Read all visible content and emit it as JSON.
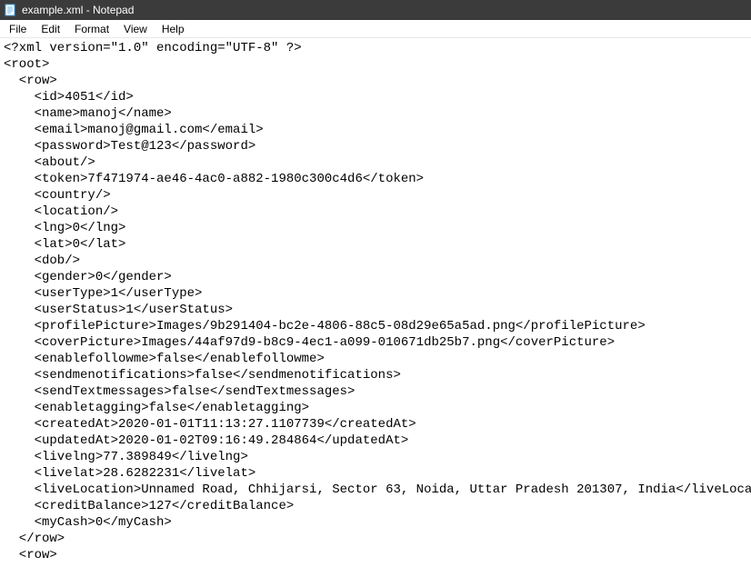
{
  "window": {
    "title": "example.xml - Notepad"
  },
  "menu": {
    "file": "File",
    "edit": "Edit",
    "format": "Format",
    "view": "View",
    "help": "Help"
  },
  "content": {
    "l0": "<?xml version=\"1.0\" encoding=\"UTF-8\" ?>",
    "l1": "<root>",
    "l2": "  <row>",
    "l3": "    <id>4051</id>",
    "l4": "    <name>manoj</name>",
    "l5": "    <email>manoj@gmail.com</email>",
    "l6": "    <password>Test@123</password>",
    "l7": "    <about/>",
    "l8": "    <token>7f471974-ae46-4ac0-a882-1980c300c4d6</token>",
    "l9": "    <country/>",
    "l10": "    <location/>",
    "l11": "    <lng>0</lng>",
    "l12": "    <lat>0</lat>",
    "l13": "    <dob/>",
    "l14": "    <gender>0</gender>",
    "l15": "    <userType>1</userType>",
    "l16": "    <userStatus>1</userStatus>",
    "l17": "    <profilePicture>Images/9b291404-bc2e-4806-88c5-08d29e65a5ad.png</profilePicture>",
    "l18": "    <coverPicture>Images/44af97d9-b8c9-4ec1-a099-010671db25b7.png</coverPicture>",
    "l19": "    <enablefollowme>false</enablefollowme>",
    "l20": "    <sendmenotifications>false</sendmenotifications>",
    "l21": "    <sendTextmessages>false</sendTextmessages>",
    "l22": "    <enabletagging>false</enabletagging>",
    "l23": "    <createdAt>2020-01-01T11:13:27.1107739</createdAt>",
    "l24": "    <updatedAt>2020-01-02T09:16:49.284864</updatedAt>",
    "l25": "    <livelng>77.389849</livelng>",
    "l26": "    <livelat>28.6282231</livelat>",
    "l27": "    <liveLocation>Unnamed Road, Chhijarsi, Sector 63, Noida, Uttar Pradesh 201307, India</liveLocation>",
    "l28": "    <creditBalance>127</creditBalance>",
    "l29": "    <myCash>0</myCash>",
    "l30": "  </row>",
    "l31": "  <row>"
  }
}
